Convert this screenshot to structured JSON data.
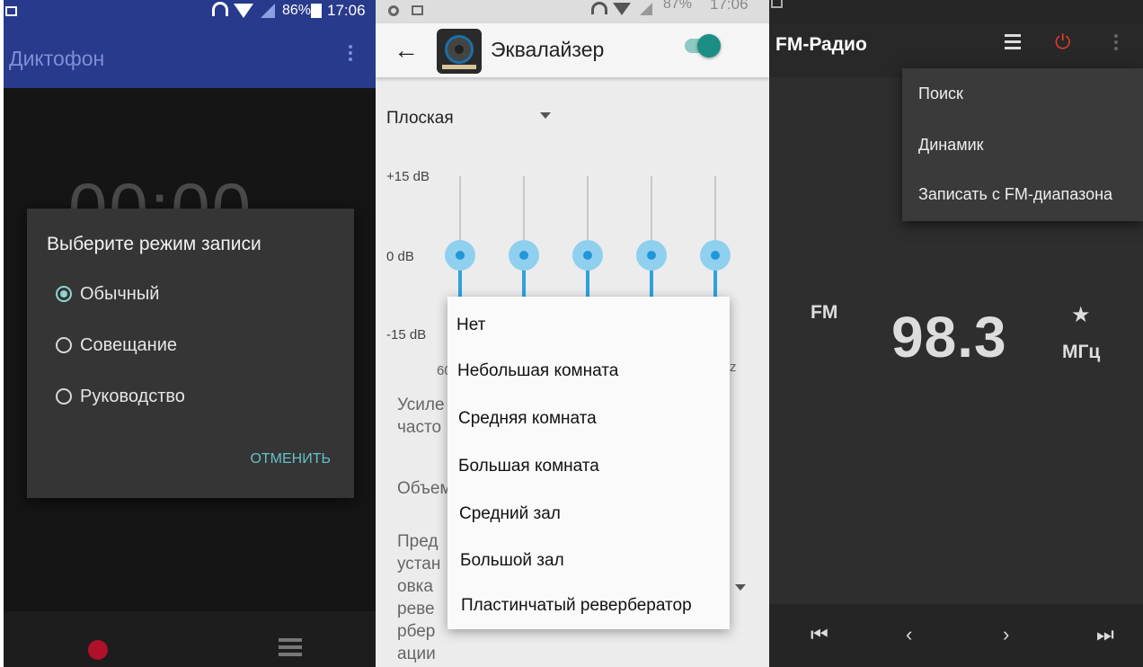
{
  "recorder": {
    "status": {
      "battery": "86%",
      "time": "17:06"
    },
    "app_title": "Диктофон",
    "timer": "00:00",
    "dialog": {
      "title": "Выберите режим записи",
      "options": [
        {
          "label": "Обычный",
          "selected": true
        },
        {
          "label": "Совещание",
          "selected": false
        },
        {
          "label": "Руководство",
          "selected": false
        }
      ],
      "cancel_label": "ОТМЕНИТЬ"
    },
    "icons": [
      "image-icon",
      "headphones-icon",
      "wifi-icon",
      "signal-icon",
      "battery-icon",
      "kebab-icon",
      "record-icon",
      "list-icon"
    ]
  },
  "equalizer": {
    "status": {
      "battery": "87%",
      "time": "17:06"
    },
    "title": "Эквалайзер",
    "enabled": true,
    "preset": "Плоская",
    "db_labels": {
      "top": "+15 dB",
      "mid": "0 dB",
      "bottom": "-15 dB"
    },
    "band_levels_db": [
      0,
      0,
      0,
      0,
      0
    ],
    "band_label_start": "60",
    "band_label_end": "z",
    "background_texts": [
      "Усиле",
      "часто",
      "Объем",
      "Пред",
      "устан",
      "овка",
      "реве",
      "рбер",
      "ации"
    ],
    "reverb_menu": [
      "Нет",
      "Небольшая комната",
      "Средняя комната",
      "Большая комната",
      "Средний зал",
      "Большой зал",
      "Пластинчатый ревербератор"
    ],
    "accent_color": "#2196d8"
  },
  "radio": {
    "title": "FM-Радио",
    "menu": [
      "Поиск",
      "Динамик",
      "Записать с FM-диапазона"
    ],
    "band": "FM",
    "frequency": "98.3",
    "unit": "МГц",
    "star": "★",
    "controls": [
      "skip-previous-icon",
      "seek-back-icon",
      "seek-forward-icon",
      "skip-next-icon"
    ]
  }
}
